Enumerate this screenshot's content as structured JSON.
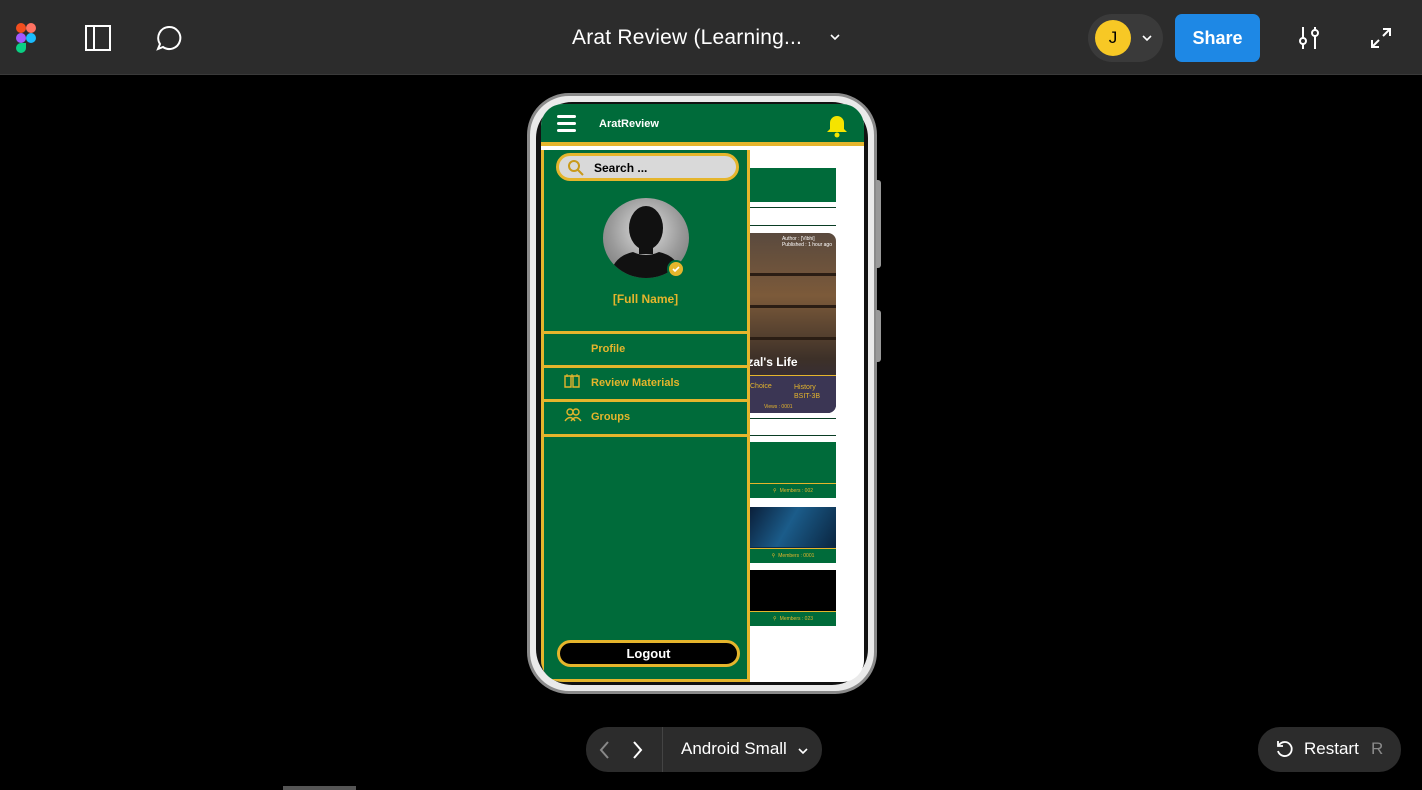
{
  "toolbar": {
    "file_title": "Arat Review (Learning...",
    "avatar_initial": "J",
    "share_label": "Share"
  },
  "app": {
    "title": "AratReview",
    "search_placeholder": "Search ...",
    "full_name": "[Full Name]",
    "menu": [
      {
        "label": "Profile",
        "icon": "profile-icon"
      },
      {
        "label": "Review Materials",
        "icon": "book-icon"
      },
      {
        "label": "Groups",
        "icon": "groups-icon"
      }
    ],
    "logout_label": "Logout"
  },
  "background_content": {
    "card": {
      "author": "Author : [Vibhi]",
      "published": "Published : 1 hour ago",
      "title": "izal's Life",
      "choice": "Choice",
      "subject": "History",
      "section": "BSIT-3B",
      "views": "Views : 0001"
    },
    "groups": [
      {
        "members": "Members : 002"
      },
      {
        "members": "Members : 0001"
      },
      {
        "members": "Members : 023"
      }
    ]
  },
  "bottom": {
    "device_label": "Android Small",
    "restart_label": "Restart",
    "restart_key": "R"
  },
  "colors": {
    "brand_green": "#006b3a",
    "gold": "#e5b52c",
    "share_blue": "#1e88e5",
    "avatar_yellow": "#f7c825"
  }
}
